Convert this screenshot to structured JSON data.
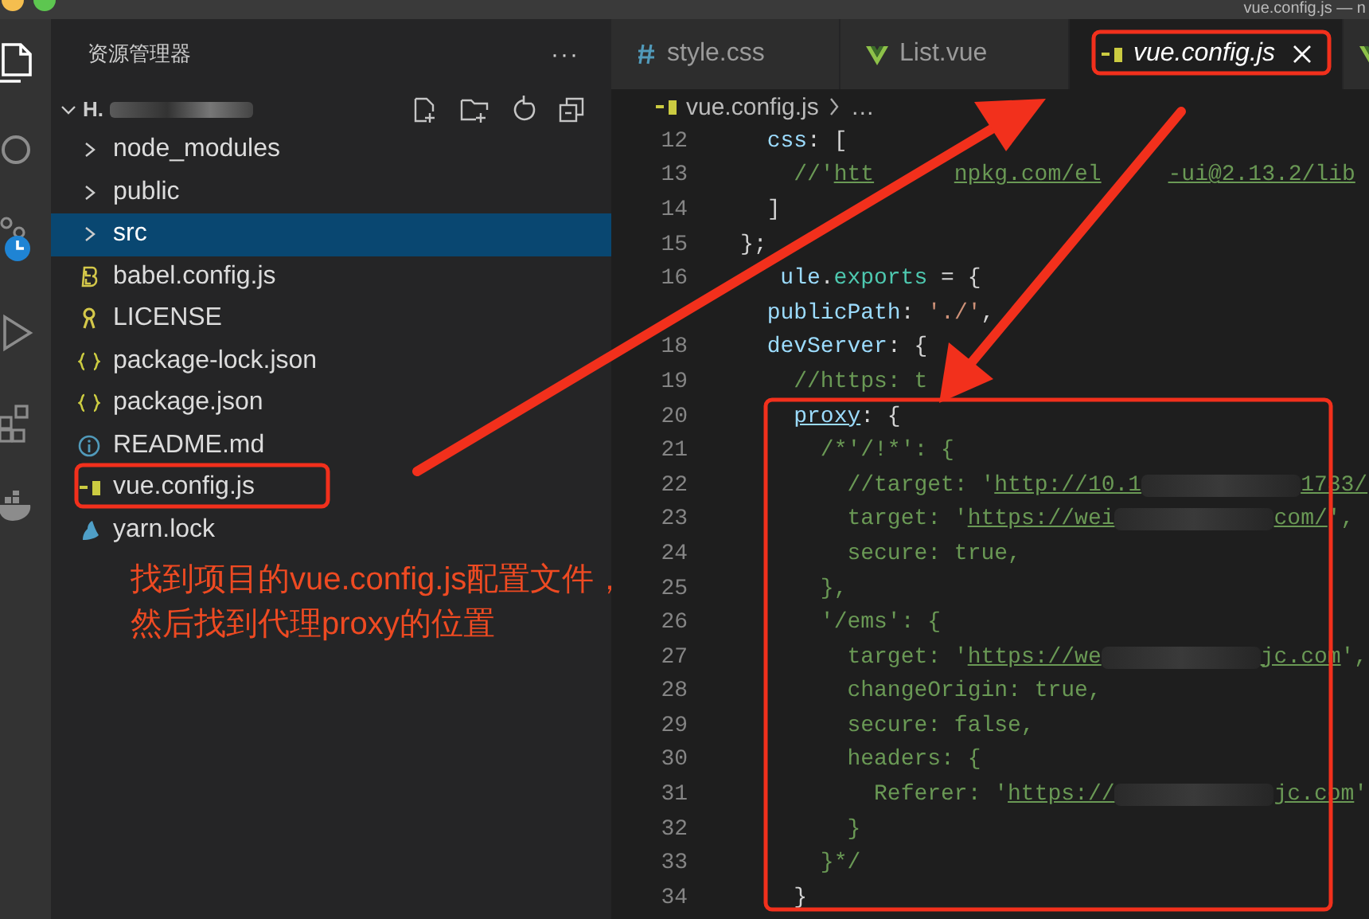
{
  "window": {
    "title": "vue.config.js — n"
  },
  "sidebar": {
    "title": "资源管理器",
    "more": "···",
    "project": {
      "label": "H.",
      "expanded": true,
      "children": [
        {
          "label": "node_modules",
          "kind": "folder",
          "expanded": false,
          "selected": false
        },
        {
          "label": "public",
          "kind": "folder",
          "expanded": false,
          "selected": false
        },
        {
          "label": "src",
          "kind": "folder",
          "expanded": false,
          "selected": true
        },
        {
          "label": "babel.config.js",
          "kind": "babel",
          "selected": false
        },
        {
          "label": "LICENSE",
          "kind": "license",
          "selected": false
        },
        {
          "label": "package-lock.json",
          "kind": "json",
          "selected": false
        },
        {
          "label": "package.json",
          "kind": "json",
          "selected": false
        },
        {
          "label": "README.md",
          "kind": "info",
          "selected": false
        },
        {
          "label": "vue.config.js",
          "kind": "js",
          "selected": false
        },
        {
          "label": "yarn.lock",
          "kind": "yarn",
          "selected": false
        }
      ]
    }
  },
  "note": [
    "找到项目的vue.config.js配置文件，",
    "然后找到代理proxy的位置"
  ],
  "tabs": [
    {
      "label": "style.css",
      "kind": "css",
      "selected": false,
      "preview": false
    },
    {
      "label": "List.vue",
      "kind": "vue",
      "selected": false,
      "preview": false
    },
    {
      "label": "vue.config.js",
      "kind": "js",
      "selected": true,
      "preview": true
    },
    {
      "kind": "vue",
      "selected": false
    }
  ],
  "breadcrumb": {
    "kind": "js",
    "items": [
      "vue.config.js",
      "…"
    ]
  },
  "code": [
    {
      "number": "12",
      "segments": [
        {
          "text": "  css",
          "kind": "key"
        },
        {
          "text": ": [",
          "kind": "punct"
        }
      ]
    },
    {
      "number": "13",
      "segments": [
        {
          "text": "    //'",
          "kind": "comment"
        },
        {
          "text": "htt",
          "kind": "link"
        },
        {
          "kind": "gap"
        },
        {
          "kind": "gap"
        },
        {
          "kind": "gap"
        },
        {
          "kind": "gap"
        },
        {
          "kind": "gap"
        },
        {
          "kind": "gap"
        },
        {
          "text": "npkg.com/el",
          "kind": "link"
        },
        {
          "kind": "gap"
        },
        {
          "kind": "gap"
        },
        {
          "kind": "gap"
        },
        {
          "kind": "gap"
        },
        {
          "kind": "gap"
        },
        {
          "text": "-ui@2.13.2/lib",
          "kind": "link"
        }
      ]
    },
    {
      "number": "14",
      "segments": [
        {
          "text": "  ]",
          "kind": "punct"
        }
      ]
    },
    {
      "number": "15",
      "segments": [
        {
          "text": "};",
          "kind": "punct"
        }
      ]
    },
    {
      "number": "16",
      "segments": [
        {
          "kind": "gap"
        },
        {
          "kind": "gap"
        },
        {
          "kind": "gap"
        },
        {
          "text": "ule",
          "kind": "key"
        },
        {
          "text": ".",
          "kind": "punct"
        },
        {
          "text": "exports",
          "kind": "object"
        },
        {
          "text": " = {",
          "kind": "punct"
        }
      ]
    },
    {
      "segments": [
        {
          "text": "  publicPath",
          "kind": "key"
        },
        {
          "text": ": ",
          "kind": "punct"
        },
        {
          "text": "'./'",
          "kind": "string"
        },
        {
          "text": ",",
          "kind": "punct"
        }
      ]
    },
    {
      "number": "18",
      "segments": [
        {
          "text": "  devServer",
          "kind": "key"
        },
        {
          "text": ": {",
          "kind": "punct"
        }
      ]
    },
    {
      "number": "19",
      "segments": [
        {
          "text": "    //https: t",
          "kind": "comment"
        }
      ]
    },
    {
      "number": "20",
      "segments": [
        {
          "text": "    proxy",
          "kind": "keylink"
        },
        {
          "text": ": {",
          "kind": "punct"
        }
      ]
    },
    {
      "number": "21",
      "segments": [
        {
          "text": "      /*'/!*': {",
          "kind": "comment"
        }
      ]
    },
    {
      "number": "22",
      "segments": [
        {
          "text": "        //target: '",
          "kind": "comment"
        },
        {
          "text": "http://10.1",
          "kind": "link"
        },
        {
          "kind": "blur"
        },
        {
          "text": "1733/",
          "kind": "link"
        }
      ]
    },
    {
      "number": "23",
      "segments": [
        {
          "text": "        target: '",
          "kind": "comment"
        },
        {
          "text": "https://wei",
          "kind": "link"
        },
        {
          "kind": "blur"
        },
        {
          "text": "com/",
          "kind": "link"
        },
        {
          "text": "',",
          "kind": "comment"
        }
      ]
    },
    {
      "number": "24",
      "segments": [
        {
          "text": "        secure: true,",
          "kind": "comment"
        }
      ]
    },
    {
      "number": "25",
      "segments": [
        {
          "text": "      },",
          "kind": "comment"
        }
      ]
    },
    {
      "number": "26",
      "segments": [
        {
          "text": "      '/ems': {",
          "kind": "comment"
        }
      ]
    },
    {
      "number": "27",
      "segments": [
        {
          "text": "        target: '",
          "kind": "comment"
        },
        {
          "text": "https://we",
          "kind": "link"
        },
        {
          "kind": "blur"
        },
        {
          "text": "jc.com",
          "kind": "link"
        },
        {
          "text": "',",
          "kind": "comment"
        }
      ]
    },
    {
      "number": "28",
      "segments": [
        {
          "text": "        changeOrigin: true,",
          "kind": "comment"
        }
      ]
    },
    {
      "number": "29",
      "segments": [
        {
          "text": "        secure: false,",
          "kind": "comment"
        }
      ]
    },
    {
      "number": "30",
      "segments": [
        {
          "text": "        headers: {",
          "kind": "comment"
        }
      ]
    },
    {
      "number": "31",
      "segments": [
        {
          "text": "          Referer: '",
          "kind": "comment"
        },
        {
          "text": "https://",
          "kind": "link"
        },
        {
          "kind": "blur"
        },
        {
          "text": "jc.com",
          "kind": "link"
        },
        {
          "text": "'",
          "kind": "comment"
        }
      ]
    },
    {
      "number": "32",
      "segments": [
        {
          "text": "        }",
          "kind": "comment"
        }
      ]
    },
    {
      "number": "33",
      "segments": [
        {
          "text": "      }*/",
          "kind": "comment"
        }
      ]
    },
    {
      "number": "34",
      "segments": [
        {
          "text": "    }",
          "kind": "punct"
        }
      ]
    }
  ]
}
